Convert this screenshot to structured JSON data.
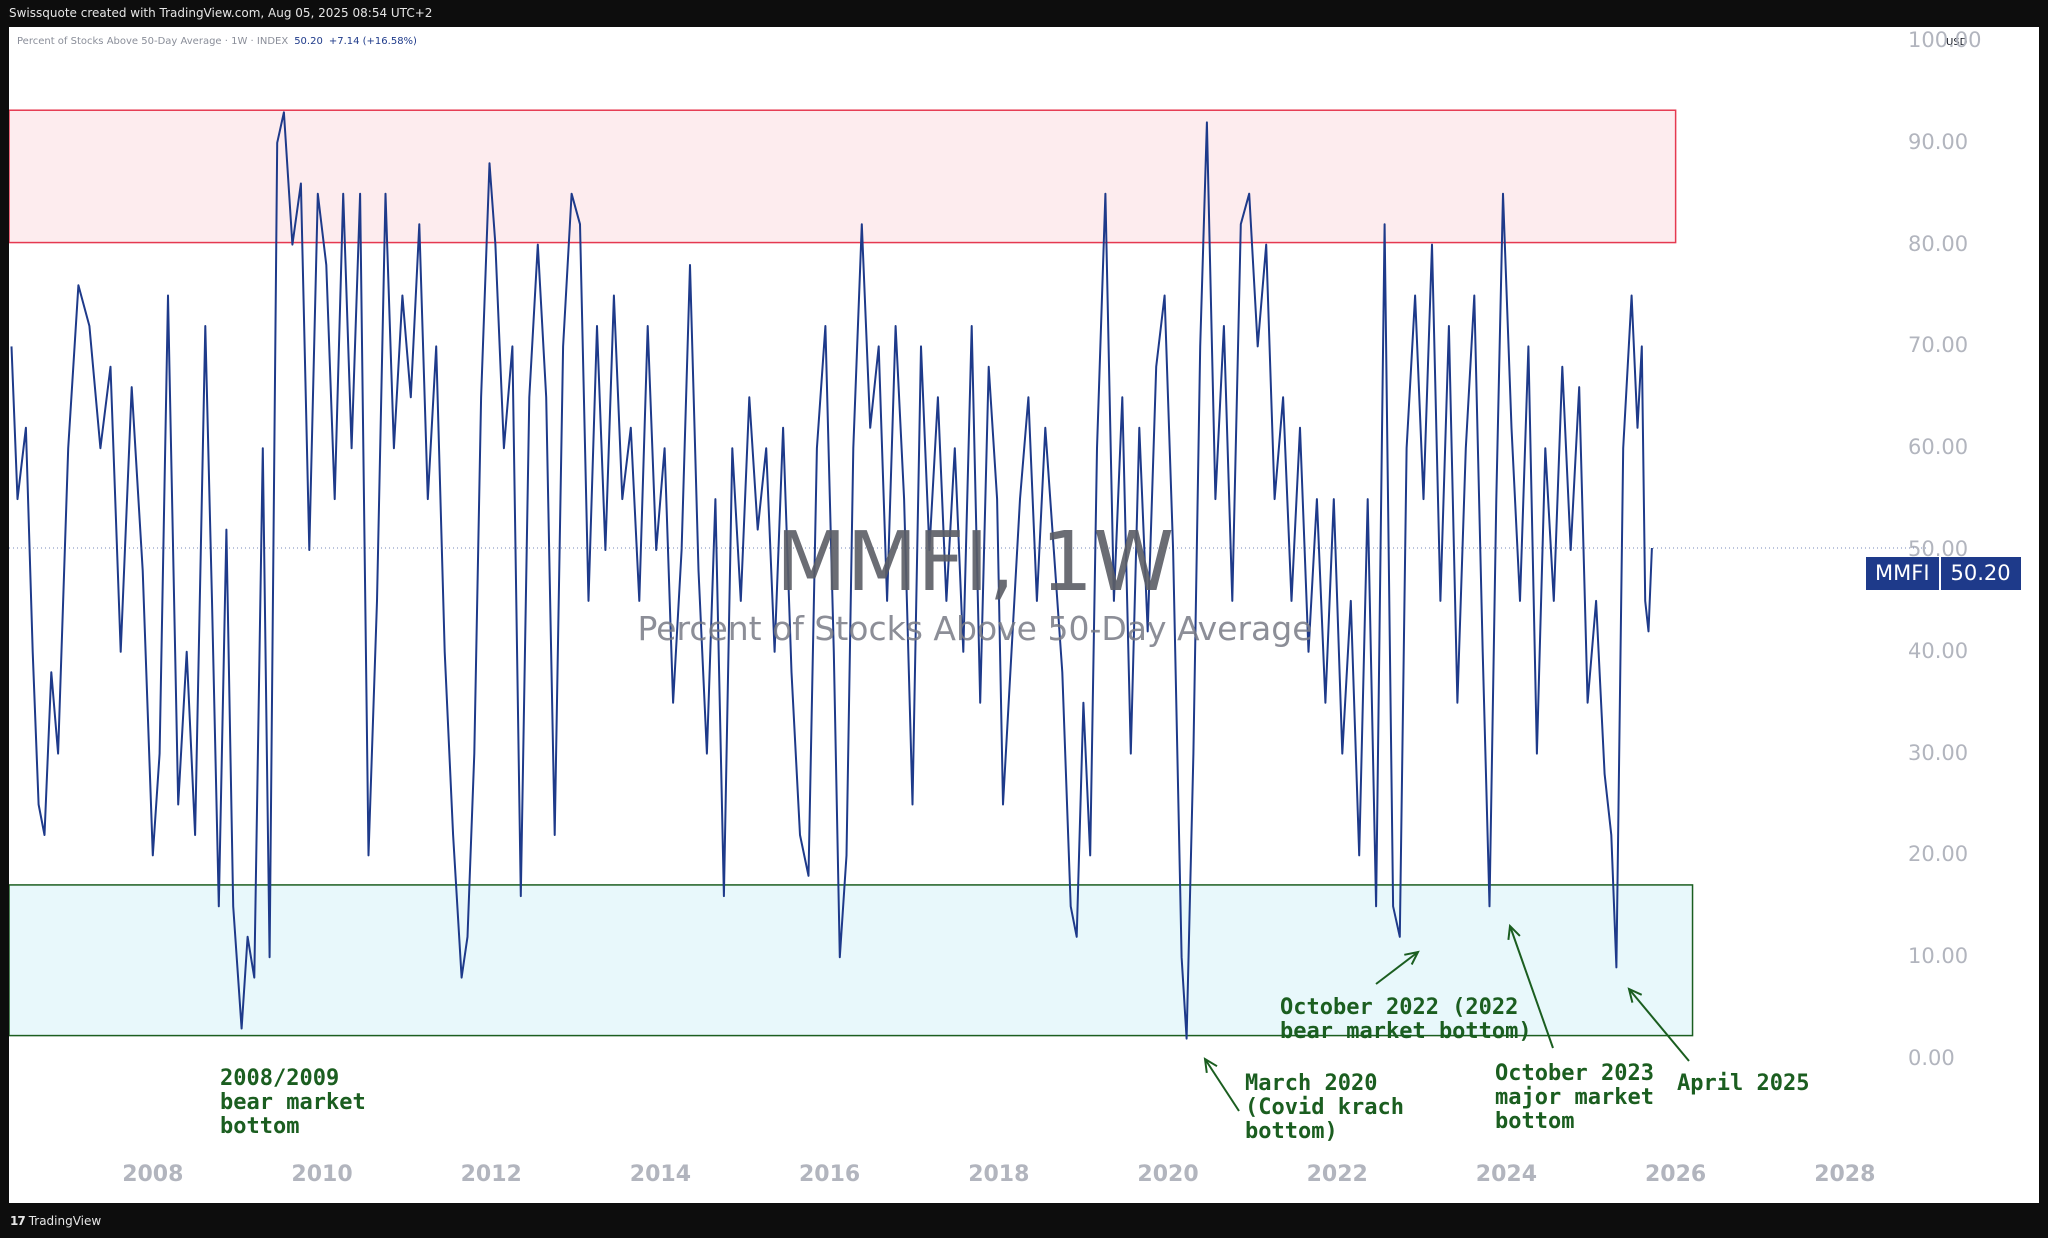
{
  "header": {
    "credit": "Swissquote created with TradingView.com, Aug 05, 2025 08:54 UTC+2"
  },
  "footer": {
    "brand": "TradingView",
    "brand_mark": "17"
  },
  "legend": {
    "title": "Percent of Stocks Above 50-Day Average · 1W · INDEX",
    "last": "50.20",
    "change": "+7.14 (+16.58%)"
  },
  "currency": "USD",
  "watermark": {
    "title": "MMFI, 1W",
    "subtitle": "Percent of Stocks Above 50-Day Average"
  },
  "price_tag": {
    "symbol": "MMFI",
    "value": "50.20"
  },
  "colors": {
    "line": "#1e3a8a",
    "upper_zone_fill": "#fdecee",
    "upper_zone_stroke": "#e53950",
    "lower_zone_fill": "#e8f8fb",
    "lower_zone_stroke": "#1b5e20",
    "annotation": "#1b5e20"
  },
  "annotations": [
    {
      "text": "2008/2009\nbear market\nbottom"
    },
    {
      "text": "March 2020\n(Covid krach\nbottom)"
    },
    {
      "text": "October 2022 (2022\nbear market bottom)"
    },
    {
      "text": "October 2023\nmajor market\nbottom"
    },
    {
      "text": "April 2025"
    }
  ],
  "chart_data": {
    "type": "line",
    "title": "MMFI, 1W",
    "subtitle": "Percent of Stocks Above 50-Day Average",
    "xlabel": "",
    "ylabel": "",
    "x_ticks": [
      "2008",
      "2010",
      "2012",
      "2014",
      "2016",
      "2018",
      "2020",
      "2022",
      "2024",
      "2026",
      "2028"
    ],
    "y_ticks": [
      "0.00",
      "10.00",
      "20.00",
      "30.00",
      "40.00",
      "50.00",
      "60.00",
      "70.00",
      "80.00",
      "90.00",
      "100.00"
    ],
    "ylim": [
      0,
      100
    ],
    "xlim": [
      2006.3,
      2028.6
    ],
    "grid": false,
    "last_value": 50.2,
    "zones": [
      {
        "name": "overbought",
        "x_start": 2006.3,
        "x_end": 2026.0,
        "y_low": 80.2,
        "y_high": 93.2
      },
      {
        "name": "oversold",
        "x_start": 2006.3,
        "x_end": 2026.2,
        "y_low": 2.3,
        "y_high": 17.1
      }
    ],
    "series": [
      {
        "values": [
          [
            2006.33,
            70
          ],
          [
            2006.4,
            55
          ],
          [
            2006.5,
            62
          ],
          [
            2006.58,
            40
          ],
          [
            2006.65,
            25
          ],
          [
            2006.72,
            22
          ],
          [
            2006.8,
            38
          ],
          [
            2006.88,
            30
          ],
          [
            2007.0,
            60
          ],
          [
            2007.12,
            76
          ],
          [
            2007.25,
            72
          ],
          [
            2007.38,
            60
          ],
          [
            2007.5,
            68
          ],
          [
            2007.62,
            40
          ],
          [
            2007.75,
            66
          ],
          [
            2007.88,
            48
          ],
          [
            2008.0,
            20
          ],
          [
            2008.08,
            30
          ],
          [
            2008.18,
            75
          ],
          [
            2008.3,
            25
          ],
          [
            2008.4,
            40
          ],
          [
            2008.5,
            22
          ],
          [
            2008.62,
            72
          ],
          [
            2008.7,
            45
          ],
          [
            2008.78,
            15
          ],
          [
            2008.87,
            52
          ],
          [
            2008.95,
            15
          ],
          [
            2009.05,
            3
          ],
          [
            2009.12,
            12
          ],
          [
            2009.2,
            8
          ],
          [
            2009.3,
            60
          ],
          [
            2009.38,
            10
          ],
          [
            2009.47,
            90
          ],
          [
            2009.55,
            93
          ],
          [
            2009.65,
            80
          ],
          [
            2009.75,
            86
          ],
          [
            2009.85,
            50
          ],
          [
            2009.95,
            85
          ],
          [
            2010.05,
            78
          ],
          [
            2010.15,
            55
          ],
          [
            2010.25,
            85
          ],
          [
            2010.35,
            60
          ],
          [
            2010.45,
            85
          ],
          [
            2010.55,
            20
          ],
          [
            2010.65,
            45
          ],
          [
            2010.75,
            85
          ],
          [
            2010.85,
            60
          ],
          [
            2010.95,
            75
          ],
          [
            2011.05,
            65
          ],
          [
            2011.15,
            82
          ],
          [
            2011.25,
            55
          ],
          [
            2011.35,
            70
          ],
          [
            2011.45,
            40
          ],
          [
            2011.55,
            22
          ],
          [
            2011.65,
            8
          ],
          [
            2011.72,
            12
          ],
          [
            2011.8,
            30
          ],
          [
            2011.88,
            65
          ],
          [
            2011.98,
            88
          ],
          [
            2012.05,
            80
          ],
          [
            2012.15,
            60
          ],
          [
            2012.25,
            70
          ],
          [
            2012.35,
            16
          ],
          [
            2012.45,
            65
          ],
          [
            2012.55,
            80
          ],
          [
            2012.65,
            65
          ],
          [
            2012.75,
            22
          ],
          [
            2012.85,
            70
          ],
          [
            2012.95,
            85
          ],
          [
            2013.05,
            82
          ],
          [
            2013.15,
            45
          ],
          [
            2013.25,
            72
          ],
          [
            2013.35,
            50
          ],
          [
            2013.45,
            75
          ],
          [
            2013.55,
            55
          ],
          [
            2013.65,
            62
          ],
          [
            2013.75,
            45
          ],
          [
            2013.85,
            72
          ],
          [
            2013.95,
            50
          ],
          [
            2014.05,
            60
          ],
          [
            2014.15,
            35
          ],
          [
            2014.25,
            50
          ],
          [
            2014.35,
            78
          ],
          [
            2014.45,
            48
          ],
          [
            2014.55,
            30
          ],
          [
            2014.65,
            55
          ],
          [
            2014.75,
            16
          ],
          [
            2014.85,
            60
          ],
          [
            2014.95,
            45
          ],
          [
            2015.05,
            65
          ],
          [
            2015.15,
            52
          ],
          [
            2015.25,
            60
          ],
          [
            2015.35,
            40
          ],
          [
            2015.45,
            62
          ],
          [
            2015.55,
            38
          ],
          [
            2015.65,
            22
          ],
          [
            2015.75,
            18
          ],
          [
            2015.85,
            60
          ],
          [
            2015.95,
            72
          ],
          [
            2016.05,
            40
          ],
          [
            2016.12,
            10
          ],
          [
            2016.2,
            20
          ],
          [
            2016.28,
            60
          ],
          [
            2016.38,
            82
          ],
          [
            2016.48,
            62
          ],
          [
            2016.58,
            70
          ],
          [
            2016.68,
            45
          ],
          [
            2016.78,
            72
          ],
          [
            2016.88,
            55
          ],
          [
            2016.98,
            25
          ],
          [
            2017.08,
            70
          ],
          [
            2017.18,
            50
          ],
          [
            2017.28,
            65
          ],
          [
            2017.38,
            45
          ],
          [
            2017.48,
            60
          ],
          [
            2017.58,
            40
          ],
          [
            2017.68,
            72
          ],
          [
            2017.78,
            35
          ],
          [
            2017.88,
            68
          ],
          [
            2017.98,
            55
          ],
          [
            2018.05,
            25
          ],
          [
            2018.15,
            40
          ],
          [
            2018.25,
            55
          ],
          [
            2018.35,
            65
          ],
          [
            2018.45,
            45
          ],
          [
            2018.55,
            62
          ],
          [
            2018.65,
            50
          ],
          [
            2018.75,
            38
          ],
          [
            2018.85,
            15
          ],
          [
            2018.92,
            12
          ],
          [
            2019.0,
            35
          ],
          [
            2019.08,
            20
          ],
          [
            2019.16,
            60
          ],
          [
            2019.26,
            85
          ],
          [
            2019.36,
            45
          ],
          [
            2019.46,
            65
          ],
          [
            2019.56,
            30
          ],
          [
            2019.66,
            62
          ],
          [
            2019.76,
            42
          ],
          [
            2019.86,
            68
          ],
          [
            2019.96,
            75
          ],
          [
            2020.06,
            50
          ],
          [
            2020.16,
            10
          ],
          [
            2020.22,
            2
          ],
          [
            2020.3,
            30
          ],
          [
            2020.38,
            70
          ],
          [
            2020.46,
            92
          ],
          [
            2020.56,
            55
          ],
          [
            2020.66,
            72
          ],
          [
            2020.76,
            45
          ],
          [
            2020.86,
            82
          ],
          [
            2020.96,
            85
          ],
          [
            2021.06,
            70
          ],
          [
            2021.16,
            80
          ],
          [
            2021.26,
            55
          ],
          [
            2021.36,
            65
          ],
          [
            2021.46,
            45
          ],
          [
            2021.56,
            62
          ],
          [
            2021.66,
            40
          ],
          [
            2021.76,
            55
          ],
          [
            2021.86,
            35
          ],
          [
            2021.96,
            55
          ],
          [
            2022.06,
            30
          ],
          [
            2022.16,
            45
          ],
          [
            2022.26,
            20
          ],
          [
            2022.36,
            55
          ],
          [
            2022.46,
            15
          ],
          [
            2022.56,
            82
          ],
          [
            2022.66,
            15
          ],
          [
            2022.74,
            12
          ],
          [
            2022.82,
            60
          ],
          [
            2022.92,
            75
          ],
          [
            2023.02,
            55
          ],
          [
            2023.12,
            80
          ],
          [
            2023.22,
            45
          ],
          [
            2023.32,
            72
          ],
          [
            2023.42,
            35
          ],
          [
            2023.52,
            60
          ],
          [
            2023.62,
            75
          ],
          [
            2023.72,
            40
          ],
          [
            2023.8,
            15
          ],
          [
            2023.88,
            55
          ],
          [
            2023.96,
            85
          ],
          [
            2024.06,
            62
          ],
          [
            2024.16,
            45
          ],
          [
            2024.26,
            70
          ],
          [
            2024.36,
            30
          ],
          [
            2024.46,
            60
          ],
          [
            2024.56,
            45
          ],
          [
            2024.66,
            68
          ],
          [
            2024.76,
            50
          ],
          [
            2024.86,
            66
          ],
          [
            2024.96,
            35
          ],
          [
            2025.06,
            45
          ],
          [
            2025.16,
            28
          ],
          [
            2025.24,
            22
          ],
          [
            2025.3,
            9
          ],
          [
            2025.38,
            60
          ],
          [
            2025.48,
            75
          ],
          [
            2025.55,
            62
          ],
          [
            2025.6,
            70
          ],
          [
            2025.64,
            45
          ],
          [
            2025.68,
            42
          ],
          [
            2025.72,
            50.2
          ]
        ]
      }
    ]
  }
}
